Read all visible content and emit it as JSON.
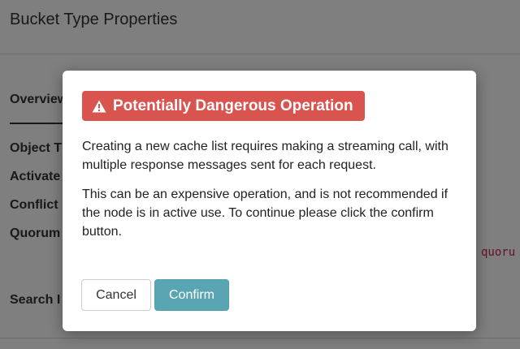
{
  "page": {
    "title": "Bucket Type Properties",
    "tab_overview": "Overview",
    "properties": [
      "Object T",
      "Activate",
      "Conflict",
      "Quorum"
    ],
    "search_label": "Search I",
    "quorum_code": "quoru"
  },
  "modal": {
    "title": "Potentially Dangerous Operation",
    "icon": "warning-triangle-icon",
    "paragraph1": "Creating a new cache list requires making a streaming call, with multiple response messages sent for each request.",
    "paragraph2": "This can be an expensive operation, and is not recommended if the node is in active use. To continue please click the confirm button.",
    "cancel_label": "Cancel",
    "confirm_label": "Confirm"
  },
  "colors": {
    "danger": "#d9534f",
    "confirm": "#5aa5b3"
  }
}
